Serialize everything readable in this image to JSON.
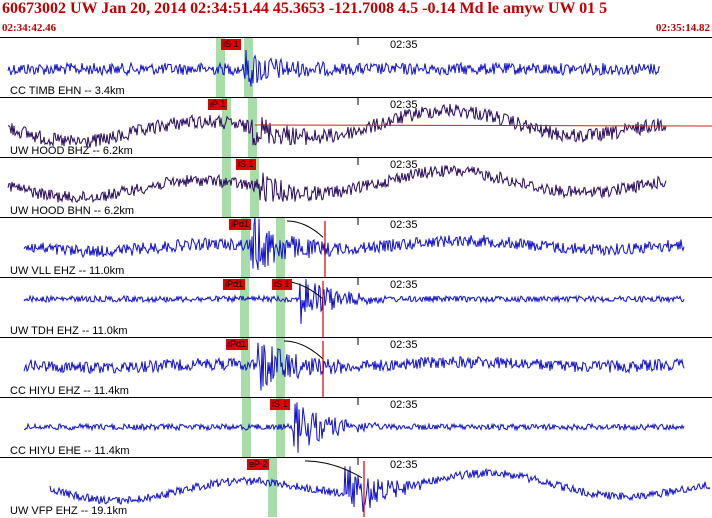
{
  "header": {
    "title": "60673002 UW Jan 20, 2014 02:34:51.44   45.3653 -121.7008  4.5 -0.14 Md le amyw UW 01   5",
    "start_time": "02:34:42.46",
    "end_time": "02:35:14.82"
  },
  "time_mark_label": "02:35",
  "colors": {
    "header_text": "#c00000",
    "trace_blue": "#1010d0",
    "trace_purple": "#2a0a5e",
    "pick_flag": "#e00000",
    "pick_line": "#d00000",
    "pick_window": "#a8dca8",
    "model_curve": "#cc2222"
  },
  "channels": [
    {
      "label": "CC TIMB EHN -- 3.4km",
      "color": "blue",
      "picks": [
        {
          "label": "iS 1"
        }
      ]
    },
    {
      "label": "UW HOOD BHZ -- 6.2km",
      "color": "purple",
      "picks": [
        {
          "label": "iP 1"
        }
      ]
    },
    {
      "label": "UW HOOD BHN -- 6.2km",
      "color": "purple",
      "picks": [
        {
          "label": "iS 1"
        }
      ]
    },
    {
      "label": "UW VLL EHZ -- 11.0km",
      "color": "blue",
      "picks": [
        {
          "label": "iPd1"
        }
      ]
    },
    {
      "label": "UW TDH EHZ -- 11.0km",
      "color": "blue",
      "picks": [
        {
          "label": "iPd1"
        },
        {
          "label": "iS 1"
        }
      ]
    },
    {
      "label": "CC HIYU EHZ -- 11.4km",
      "color": "blue",
      "picks": [
        {
          "label": "iPd1"
        }
      ]
    },
    {
      "label": "CC HIYU EHE -- 11.4km",
      "color": "blue",
      "picks": [
        {
          "label": "iS 1"
        }
      ]
    },
    {
      "label": "UW VFP EHZ -- 19.1km",
      "color": "blue",
      "picks": [
        {
          "label": "eP 2"
        }
      ]
    }
  ]
}
